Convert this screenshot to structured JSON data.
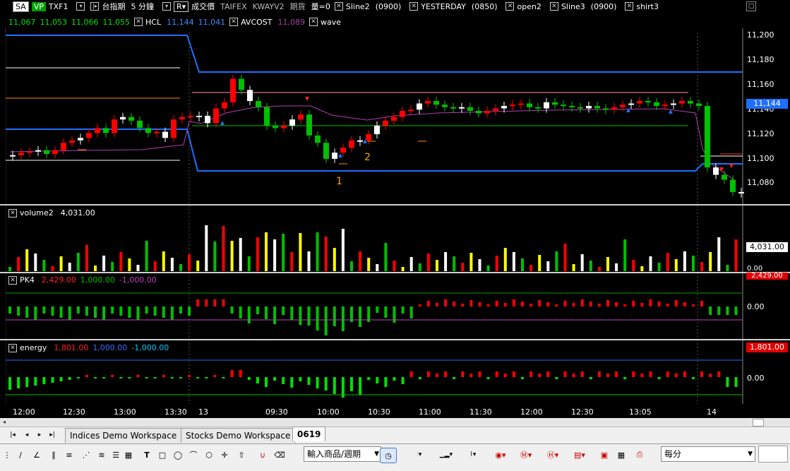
{
  "header": {
    "row1": {
      "sa": "SA",
      "vp": "VP",
      "symbol": "TXF1",
      "exchange_name": "台指期",
      "interval": "5 分鐘",
      "price_type": "成交價",
      "source": "TAIFEX",
      "ind1": "KWAYV2",
      "kind": "期貨",
      "qty": "量=0",
      "sline2": "Sline2",
      "sline2_time": "(0900)",
      "yesterday": "YESTERDAY",
      "yesterday_time": "(0850)",
      "open2": "open2",
      "sline3": "Sline3",
      "sline3_time": "(0900)",
      "shirt3": "shirt3"
    },
    "row2": {
      "v1": "11,067",
      "v2": "11,053",
      "v3": "11,066",
      "v4": "11,055",
      "hcl": "HCL",
      "hcl1": "11,144",
      "hcl2": "11,041",
      "avcost": "AVCOST",
      "avcost_v": "11,089",
      "wave": "wave"
    }
  },
  "price_axis": {
    "ticks": [
      "11,200",
      "11,180",
      "11,160",
      "11,140",
      "11,120",
      "11,100",
      "11,080"
    ],
    "current": "11,144"
  },
  "annotations": {
    "n1": "1",
    "n2": "2"
  },
  "volume_panel": {
    "title": "volume2",
    "value": "4,031.00",
    "axis_current": "4,031.00",
    "axis_zero": "0.00"
  },
  "pk4_panel": {
    "title": "PK4",
    "v1": "2,429.00",
    "v2": "1,000.00",
    "v3": "-1,000.00",
    "axis_top": "2,429.00",
    "axis_zero": "0.00"
  },
  "energy_panel": {
    "title": "energy",
    "v1": "1,801.00",
    "v2": "1,000.00",
    "v3": "-1,000.00",
    "axis_top": "1,801.00",
    "axis_zero": "0.00"
  },
  "time_axis": [
    "12:00",
    "12:30",
    "13:00",
    "13:30",
    "13",
    "09:30",
    "10:00",
    "10:30",
    "11:00",
    "11:30",
    "12:00",
    "12:30",
    "13:05",
    "14"
  ],
  "tabs": [
    "Indices Demo Workspace",
    "Stocks Demo Workspace",
    "0619"
  ],
  "toolbar": {
    "product_combo": "輸入商品/週期",
    "period_combo": "每分",
    "tool_T": "T",
    "tool_line": "/",
    "tool_fib": "Fib"
  },
  "colors": {
    "up": "#ff0000",
    "down": "#00c000",
    "neutral": "#ffffff",
    "blue": "#1e6fff",
    "avcost": "#b040b0",
    "yellow": "#ffff00"
  }
}
